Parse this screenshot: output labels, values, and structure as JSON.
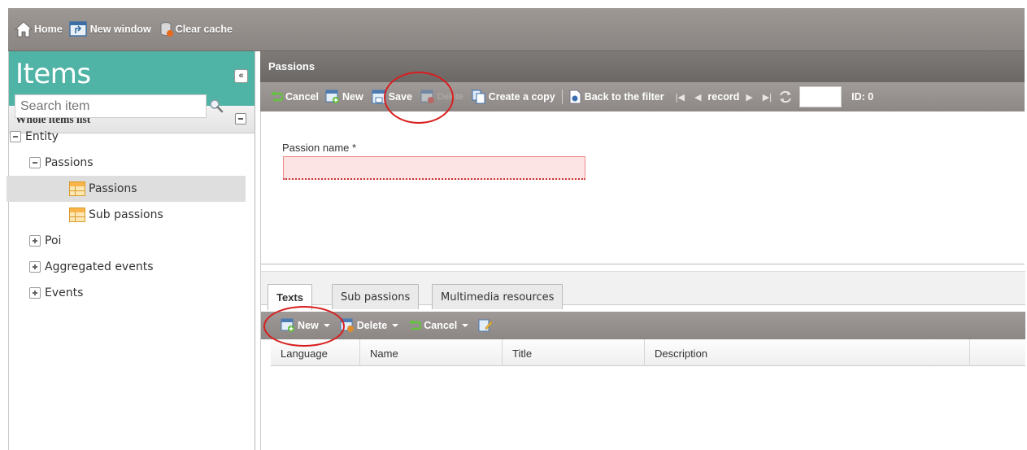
{
  "topbar": {
    "home": "Home",
    "new_window": "New window",
    "clear_cache": "Clear cache"
  },
  "left": {
    "title": "Items",
    "collapse_symbol": "«",
    "section_title": "Whole items list",
    "search_placeholder": "Search item",
    "tree": {
      "entity": "Entity",
      "passions_group": "Passions",
      "passions_leaf": "Passions",
      "sub_passions_leaf": "Sub passions",
      "poi": "Poi",
      "aggregated_events": "Aggregated events",
      "events": "Events"
    }
  },
  "form": {
    "title": "Passions",
    "toolbar": {
      "cancel": "Cancel",
      "new": "New",
      "save": "Save",
      "delete": "Delete",
      "create_copy": "Create a copy",
      "back_to_filter": "Back to the filter",
      "record": "record",
      "id_label": "ID: 0"
    },
    "field_label": "Passion name *"
  },
  "tabs": {
    "items": [
      "Texts",
      "Sub passions",
      "Multimedia resources"
    ],
    "toolbar": {
      "new": "New",
      "delete": "Delete",
      "cancel": "Cancel"
    },
    "columns": [
      "Language",
      "Name",
      "Title",
      "Description"
    ]
  },
  "colors": {
    "accent_teal": "#4fb3a5",
    "highlight_circle": "#d81e1e",
    "required_field_bg": "#fde4e4"
  }
}
